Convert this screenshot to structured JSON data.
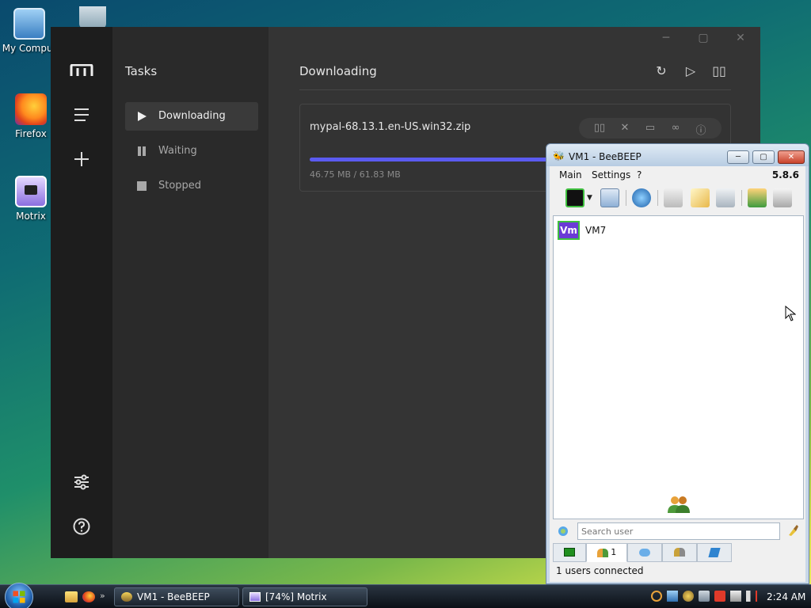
{
  "desktop": {
    "icons": [
      {
        "label": "My Comput"
      },
      {
        "label": "Firefox"
      },
      {
        "label": "Motrix"
      }
    ]
  },
  "motrix": {
    "sidebar_title": "Tasks",
    "nav": [
      {
        "label": "Downloading"
      },
      {
        "label": "Waiting"
      },
      {
        "label": "Stopped"
      }
    ],
    "page_title": "Downloading",
    "task": {
      "name": "mypal-68.13.1.en-US.win32.zip",
      "size_text": "46.75 MB / 61.83 MB",
      "progress_fraction": 0.756
    }
  },
  "beebeep": {
    "title": "VM1 - BeeBEEP",
    "menu": {
      "main": "Main",
      "settings": "Settings",
      "help": "?"
    },
    "version": "5.8.6",
    "user_badge": "Vm",
    "users": [
      {
        "name": "VM7"
      }
    ],
    "search_placeholder": "Search user",
    "users_tab_count": "1",
    "status": "1 users connected"
  },
  "taskbar": {
    "buttons": [
      {
        "label": "VM1 - BeeBEEP"
      },
      {
        "label": "[74%] Motrix"
      }
    ],
    "clock": "2:24 AM"
  },
  "colors": {
    "accent_progress": "#5b5bf0",
    "motrix_bg": "#343434",
    "vm_badge": "#6b3ad6"
  }
}
